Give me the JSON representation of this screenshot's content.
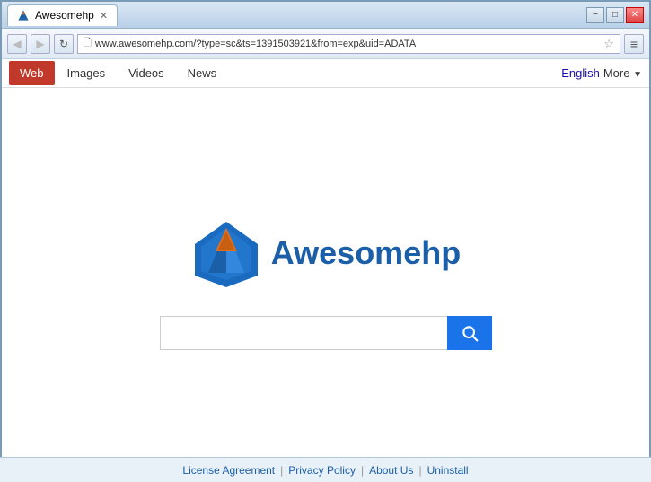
{
  "titlebar": {
    "tab_title": "Awesomehp",
    "controls": {
      "minimize": "−",
      "maximize": "□",
      "close": "✕"
    }
  },
  "toolbar": {
    "back_label": "◀",
    "forward_label": "▶",
    "refresh_label": "↻",
    "address": "www.awesomehp.com/?type=sc&ts=1391503921&from=exp&uid=ADATA",
    "star_label": "☆",
    "menu_label": "≡"
  },
  "navbar": {
    "items": [
      {
        "label": "Web",
        "active": true
      },
      {
        "label": "Images",
        "active": false
      },
      {
        "label": "Videos",
        "active": false
      },
      {
        "label": "News",
        "active": false
      }
    ],
    "lang": "English",
    "more": "More"
  },
  "main": {
    "logo_text": "Awesomehp",
    "search_placeholder": ""
  },
  "footer": {
    "license": "License Agreement",
    "privacy": "Privacy Policy",
    "about": "About Us",
    "uninstall": "Uninstall"
  }
}
